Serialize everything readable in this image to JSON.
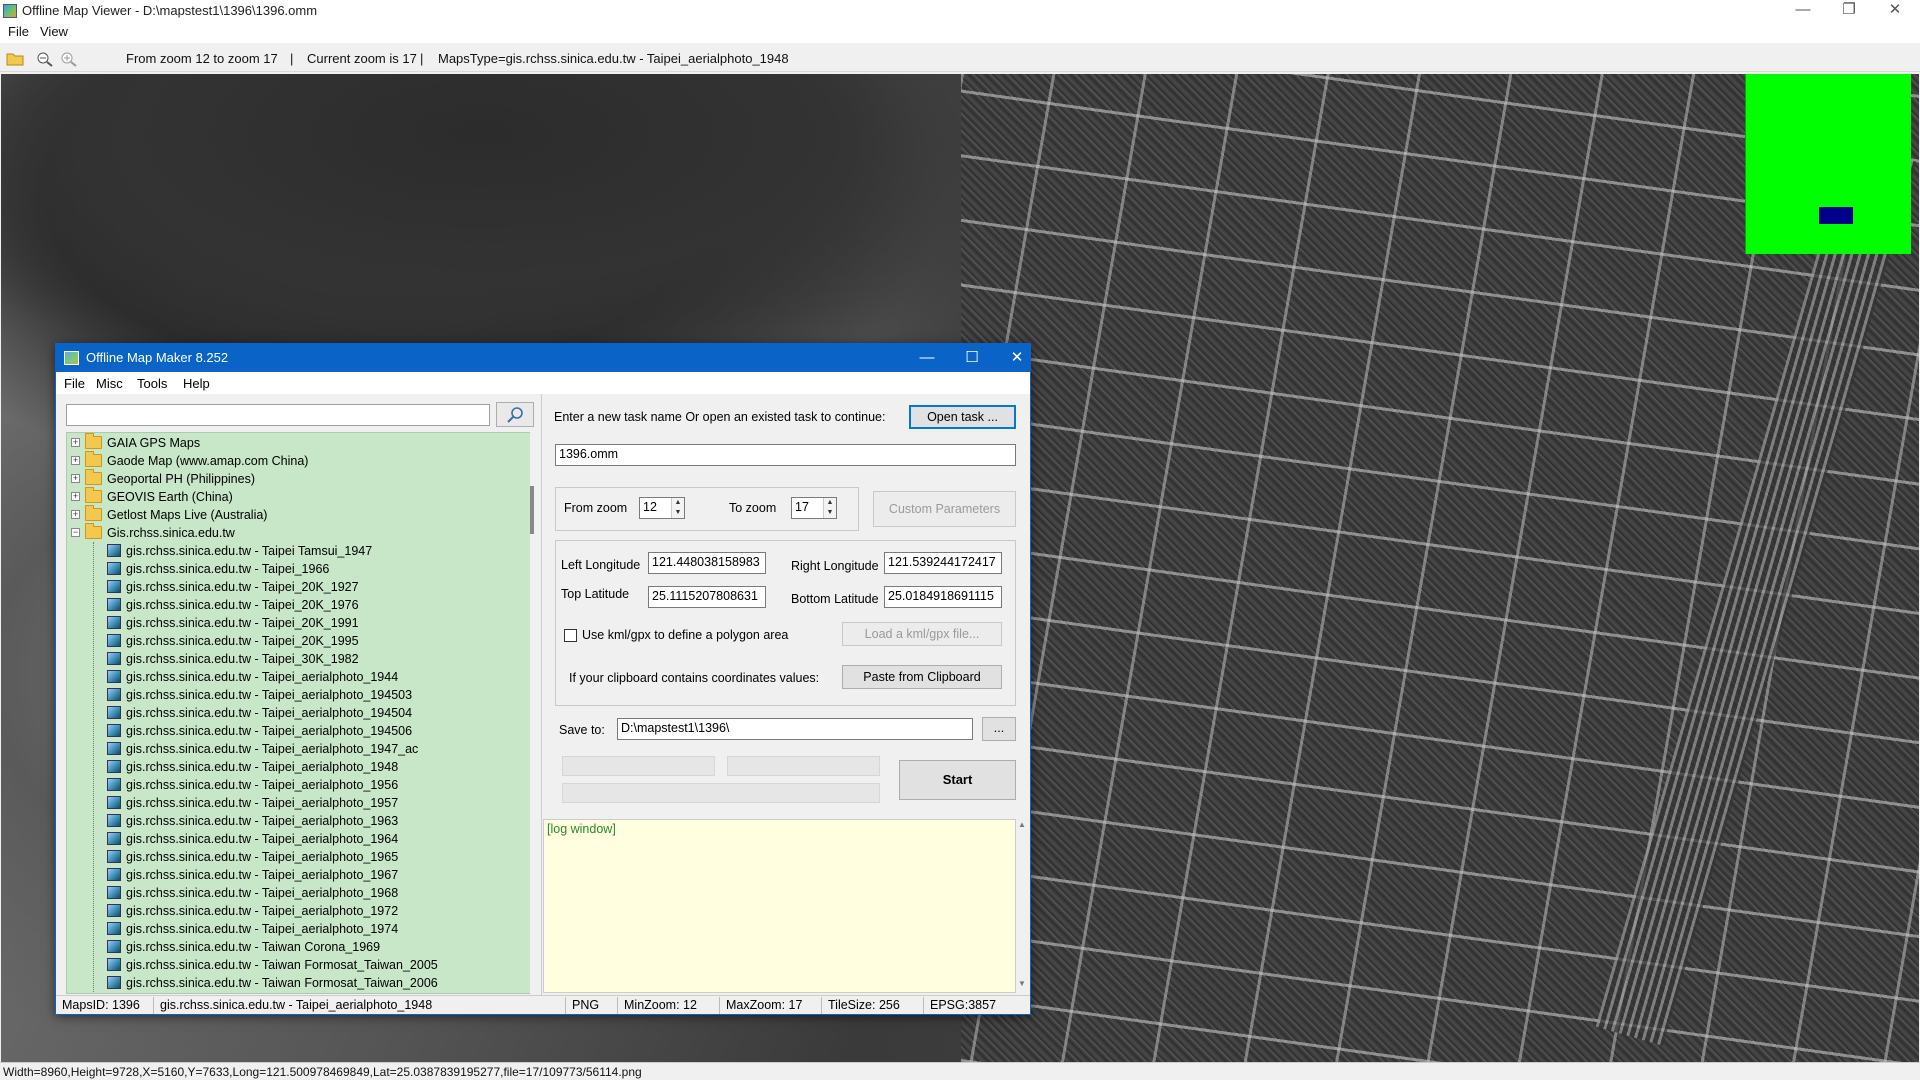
{
  "window": {
    "title": "Offline Map Viewer - D:\\mapstest1\\1396\\1396.omm",
    "controls": {
      "minimize": "—",
      "maximize": "❐",
      "close": "✕"
    }
  },
  "menu": [
    "File",
    "View"
  ],
  "toolbar": {
    "zoom_range": "From zoom 12 to zoom 17",
    "sep1": "|",
    "current_zoom": "Current zoom is 17",
    "sep2": "|",
    "maps_type": "MapsType=gis.rchss.sinica.edu.tw - Taipei_aerialphoto_1948"
  },
  "status": "Width=8960,Height=9728,X=5160,Y=7633,Long=121.500978469849,Lat=25.0387839195277,file=17/109773/56114.png",
  "colors": {
    "overview": "#00ff00",
    "viewport": "#00008b",
    "dialog_title": "#0a64c8",
    "tree_bg": "#c8e6c8",
    "log_bg": "#ffffe0"
  },
  "dialog": {
    "title": "Offline Map Maker 8.252",
    "controls": {
      "minimize": "—",
      "maximize": "☐",
      "close": "✕"
    },
    "menu": [
      "File",
      "Misc",
      "Tools",
      "Help"
    ],
    "search": {
      "value": "",
      "icon": "search-icon"
    },
    "tree": {
      "folders": [
        "GAIA GPS Maps",
        "Gaode Map (www.amap.com China)",
        "Geoportal PH (Philippines)",
        "GEOVIS Earth (China)",
        "Getlost Maps Live (Australia)",
        "Gis.rchss.sinica.edu.tw"
      ],
      "expander_collapsed": "+",
      "expander_expanded": "−",
      "items": [
        "gis.rchss.sinica.edu.tw - Taipei Tamsui_1947",
        "gis.rchss.sinica.edu.tw - Taipei_1966",
        "gis.rchss.sinica.edu.tw - Taipei_20K_1927",
        "gis.rchss.sinica.edu.tw - Taipei_20K_1976",
        "gis.rchss.sinica.edu.tw - Taipei_20K_1991",
        "gis.rchss.sinica.edu.tw - Taipei_20K_1995",
        "gis.rchss.sinica.edu.tw - Taipei_30K_1982",
        "gis.rchss.sinica.edu.tw - Taipei_aerialphoto_1944",
        "gis.rchss.sinica.edu.tw - Taipei_aerialphoto_194503",
        "gis.rchss.sinica.edu.tw - Taipei_aerialphoto_194504",
        "gis.rchss.sinica.edu.tw - Taipei_aerialphoto_194506",
        "gis.rchss.sinica.edu.tw - Taipei_aerialphoto_1947_ac",
        "gis.rchss.sinica.edu.tw - Taipei_aerialphoto_1948",
        "gis.rchss.sinica.edu.tw - Taipei_aerialphoto_1956",
        "gis.rchss.sinica.edu.tw - Taipei_aerialphoto_1957",
        "gis.rchss.sinica.edu.tw - Taipei_aerialphoto_1963",
        "gis.rchss.sinica.edu.tw - Taipei_aerialphoto_1964",
        "gis.rchss.sinica.edu.tw - Taipei_aerialphoto_1965",
        "gis.rchss.sinica.edu.tw - Taipei_aerialphoto_1967",
        "gis.rchss.sinica.edu.tw - Taipei_aerialphoto_1968",
        "gis.rchss.sinica.edu.tw - Taipei_aerialphoto_1972",
        "gis.rchss.sinica.edu.tw - Taipei_aerialphoto_1974",
        "gis.rchss.sinica.edu.tw - Taiwan Corona_1969",
        "gis.rchss.sinica.edu.tw - Taiwan Formosat_Taiwan_2005",
        "gis.rchss.sinica.edu.tw - Taiwan Formosat_Taiwan_2006"
      ]
    },
    "task": {
      "prompt": "Enter a new task name Or open an existed task to continue:",
      "open_button": "Open task ...",
      "name_value": "1396.omm"
    },
    "zoom": {
      "from_label": "From zoom",
      "from_value": "12",
      "to_label": "To zoom",
      "to_value": "17",
      "custom_button": "Custom Parameters",
      "spin_up": "▲",
      "spin_down": "▼"
    },
    "coords": {
      "left_lon_label": "Left Longitude",
      "left_lon_value": "121.448038158983",
      "right_lon_label": "Right Longitude",
      "right_lon_value": "121.539244172417",
      "top_lat_label": "Top Latitude",
      "top_lat_value": "25.1115207808631",
      "bottom_lat_label": "Bottom Latitude",
      "bottom_lat_value": "25.0184918691115",
      "kml_checkbox_label": "Use kml/gpx to define a polygon area",
      "kml_button": "Load a kml/gpx file...",
      "clipboard_label": "If your clipboard contains coordinates values:",
      "clipboard_button": "Paste from Clipboard"
    },
    "save": {
      "label": "Save to:",
      "value": "D:\\mapstest1\\1396\\",
      "browse_button": "...",
      "start_button": "Start"
    },
    "log": {
      "text": "[log window]",
      "scroll_up": "▲",
      "scroll_down": "▼"
    },
    "statusbar": {
      "maps_id": "MapsID: 1396",
      "map_name": "gis.rchss.sinica.edu.tw - Taipei_aerialphoto_1948",
      "format": "PNG",
      "min_zoom": "MinZoom: 12",
      "max_zoom": "MaxZoom: 17",
      "tile_size": "TileSize: 256",
      "epsg": "EPSG:3857"
    }
  }
}
